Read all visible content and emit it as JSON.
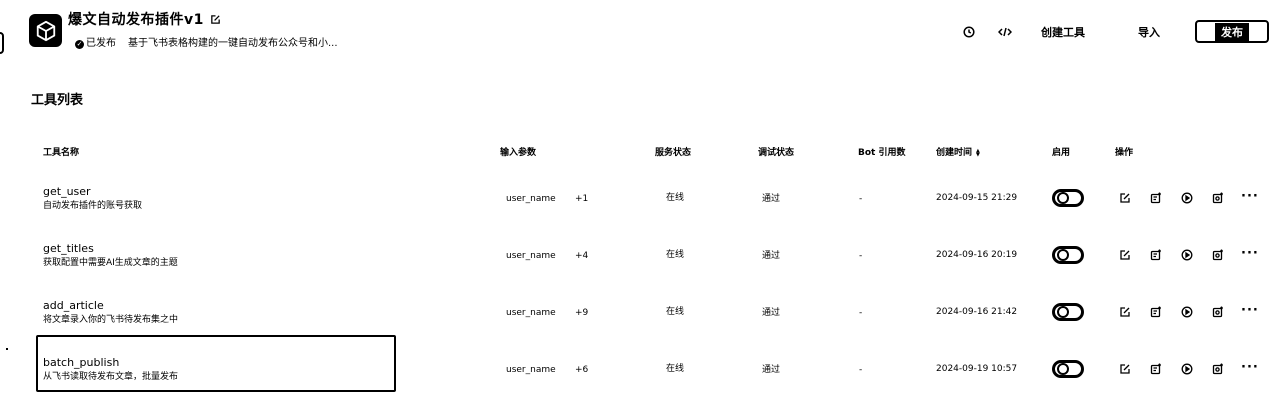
{
  "header": {
    "app_title": "爆文自动发布插件v1",
    "status_badge": "已发布",
    "description": "基于飞书表格构建的一键自动发布公众号和小...",
    "icons": {
      "app": "cube-icon",
      "edit": "edit-icon",
      "history": "clock-icon",
      "code": "code-icon"
    },
    "create_tool_label": "创建工具",
    "import_label": "导入",
    "publish_label": "发布"
  },
  "section_title": "工具列表",
  "table": {
    "columns": {
      "name": "工具名称",
      "params": "输入参数",
      "service_status": "服务状态",
      "debug_status": "调试状态",
      "bot_refs": "Bot 引用数",
      "created_time": "创建时间",
      "enabled": "启用",
      "actions": "操作"
    },
    "rows": [
      {
        "name": "get_user",
        "desc": "自动发布插件的账号获取",
        "param": "user_name",
        "extra": "+1",
        "service": "在线",
        "debug": "通过",
        "bot": "-",
        "time": "2024-09-15 21:29",
        "enabled": true
      },
      {
        "name": "get_titles",
        "desc": "获取配置中需要AI生成文章的主题",
        "param": "user_name",
        "extra": "+4",
        "service": "在线",
        "debug": "通过",
        "bot": "-",
        "time": "2024-09-16 20:19",
        "enabled": true
      },
      {
        "name": "add_article",
        "desc": "将文章录入你的飞书待发布集之中",
        "param": "user_name",
        "extra": "+9",
        "service": "在线",
        "debug": "通过",
        "bot": "-",
        "time": "2024-09-16 21:42",
        "enabled": true
      },
      {
        "name": "batch_publish",
        "desc": "从飞书读取待发布文章，批量发布",
        "param": "user_name",
        "extra": "+6",
        "service": "在线",
        "debug": "通过",
        "bot": "-",
        "time": "2024-09-19 10:57",
        "enabled": true
      }
    ],
    "more_label": "···",
    "action_icons": [
      "edit-icon",
      "copy-add-icon",
      "play-icon",
      "duplicate-icon",
      "more-icon"
    ]
  }
}
